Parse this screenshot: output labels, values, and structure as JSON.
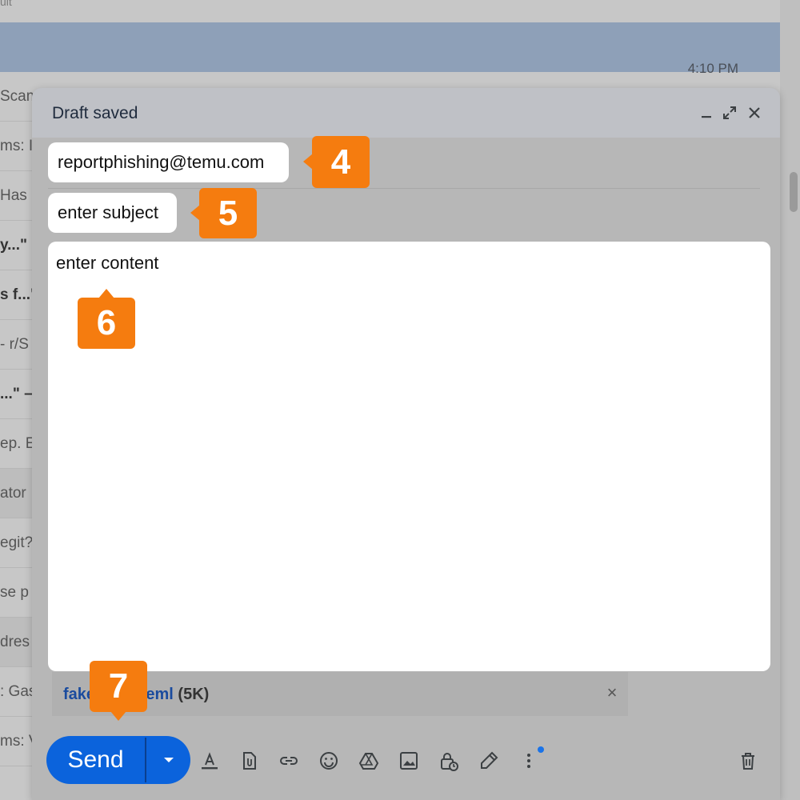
{
  "inbox": {
    "top_fragment": "ult",
    "selected_time": "4:10 PM",
    "rows": [
      {
        "text": "Scam",
        "bold": false
      },
      {
        "text": "ms: I",
        "bold": false
      },
      {
        "text": "Has",
        "bold": false
      },
      {
        "text": "y...\"",
        "bold": true
      },
      {
        "text": "s f...\"",
        "bold": true
      },
      {
        "text": "- r/S",
        "bold": false
      },
      {
        "text": "...\" –",
        "bold": true
      },
      {
        "text": "ep. E",
        "bold": false
      },
      {
        "text": "ator",
        "bold": false
      },
      {
        "text": "egit?",
        "bold": false
      },
      {
        "text": "se p",
        "bold": false
      },
      {
        "text": "dres",
        "bold": false
      },
      {
        "text": ": Gas",
        "bold": false
      },
      {
        "text": "ms: V",
        "bold": false
      }
    ]
  },
  "compose": {
    "title": "Draft saved",
    "to_value": "reportphishing@temu.com",
    "subject_value": "enter subject",
    "body_value": "enter content",
    "attachment": {
      "name": "fake-email.eml",
      "size": "(5K)"
    },
    "send_label": "Send"
  },
  "callouts": {
    "to": "4",
    "subject": "5",
    "body": "6",
    "send": "7"
  },
  "colors": {
    "callout": "#f57c0f",
    "send_button": "#0b63dc",
    "attachment_link": "#1a4b9e"
  },
  "icons": [
    "minimize-icon",
    "fullscreen-icon",
    "close-icon",
    "dropdown-arrow-icon",
    "formatting-icon",
    "attach-file-icon",
    "insert-link-icon",
    "emoji-icon",
    "google-drive-icon",
    "insert-photo-icon",
    "confidential-mode-icon",
    "signature-icon",
    "more-options-icon",
    "delete-draft-icon"
  ]
}
